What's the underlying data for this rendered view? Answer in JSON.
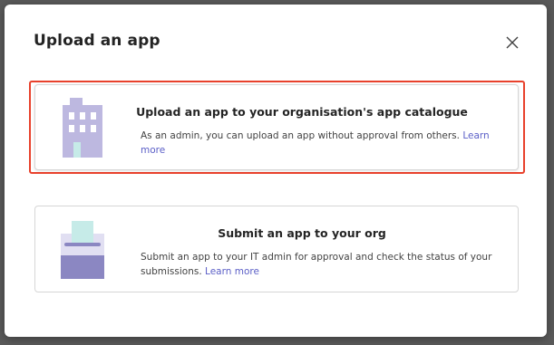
{
  "dialog": {
    "title": "Upload an app",
    "close_icon": "close-icon"
  },
  "options": [
    {
      "icon": "building-icon",
      "title": "Upload an app to your organisation's app catalogue",
      "description": "As an admin, you can upload an app without approval from others.",
      "link": "Learn more",
      "highlighted": true
    },
    {
      "icon": "submit-tray-icon",
      "title": "Submit an app to your org",
      "description": "Submit an app to your IT admin for approval and check the status of your submissions.",
      "link": "Learn more",
      "highlighted": false
    }
  ],
  "colors": {
    "highlight": "#e8412c",
    "link": "#5b5fc7",
    "icon_purple": "#bdb8e0",
    "icon_teal": "#c6ebe8",
    "icon_dark_purple": "#8b87c2"
  }
}
